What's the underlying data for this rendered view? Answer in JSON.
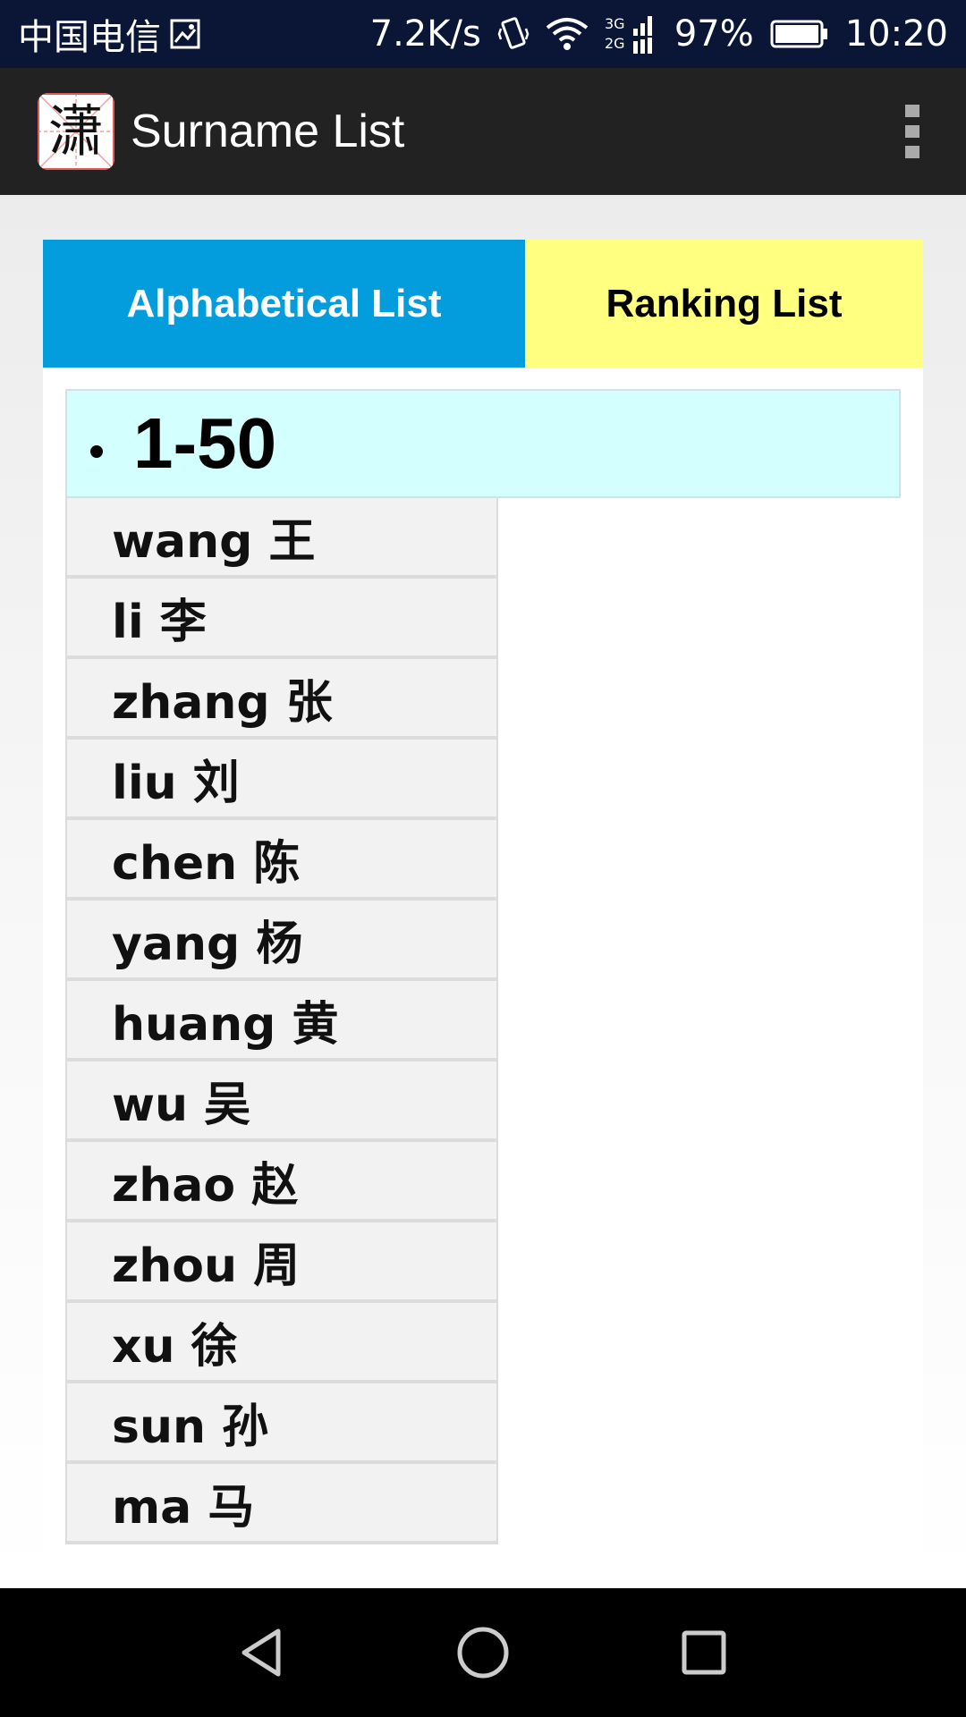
{
  "status_bar": {
    "carrier": "中国电信",
    "speed": "7.2K/s",
    "network_badge_top": "3G",
    "network_badge_bottom": "2G",
    "battery": "97%",
    "time": "10:20"
  },
  "app_bar": {
    "logo_char": "潇",
    "title": "Surname List"
  },
  "tabs": {
    "alphabetical": "Alphabetical List",
    "ranking": "Ranking List"
  },
  "group": {
    "title": "1-50"
  },
  "surnames": [
    "wang 王",
    "li 李",
    "zhang 张",
    "liu 刘",
    "chen 陈",
    "yang 杨",
    "huang 黄",
    "wu 吴",
    "zhao 赵",
    "zhou 周",
    "xu 徐",
    "sun 孙",
    "ma 马"
  ],
  "colors": {
    "tab_active": "#039ddd",
    "tab_inactive": "#ffff80",
    "group_header": "#d4ffff"
  }
}
